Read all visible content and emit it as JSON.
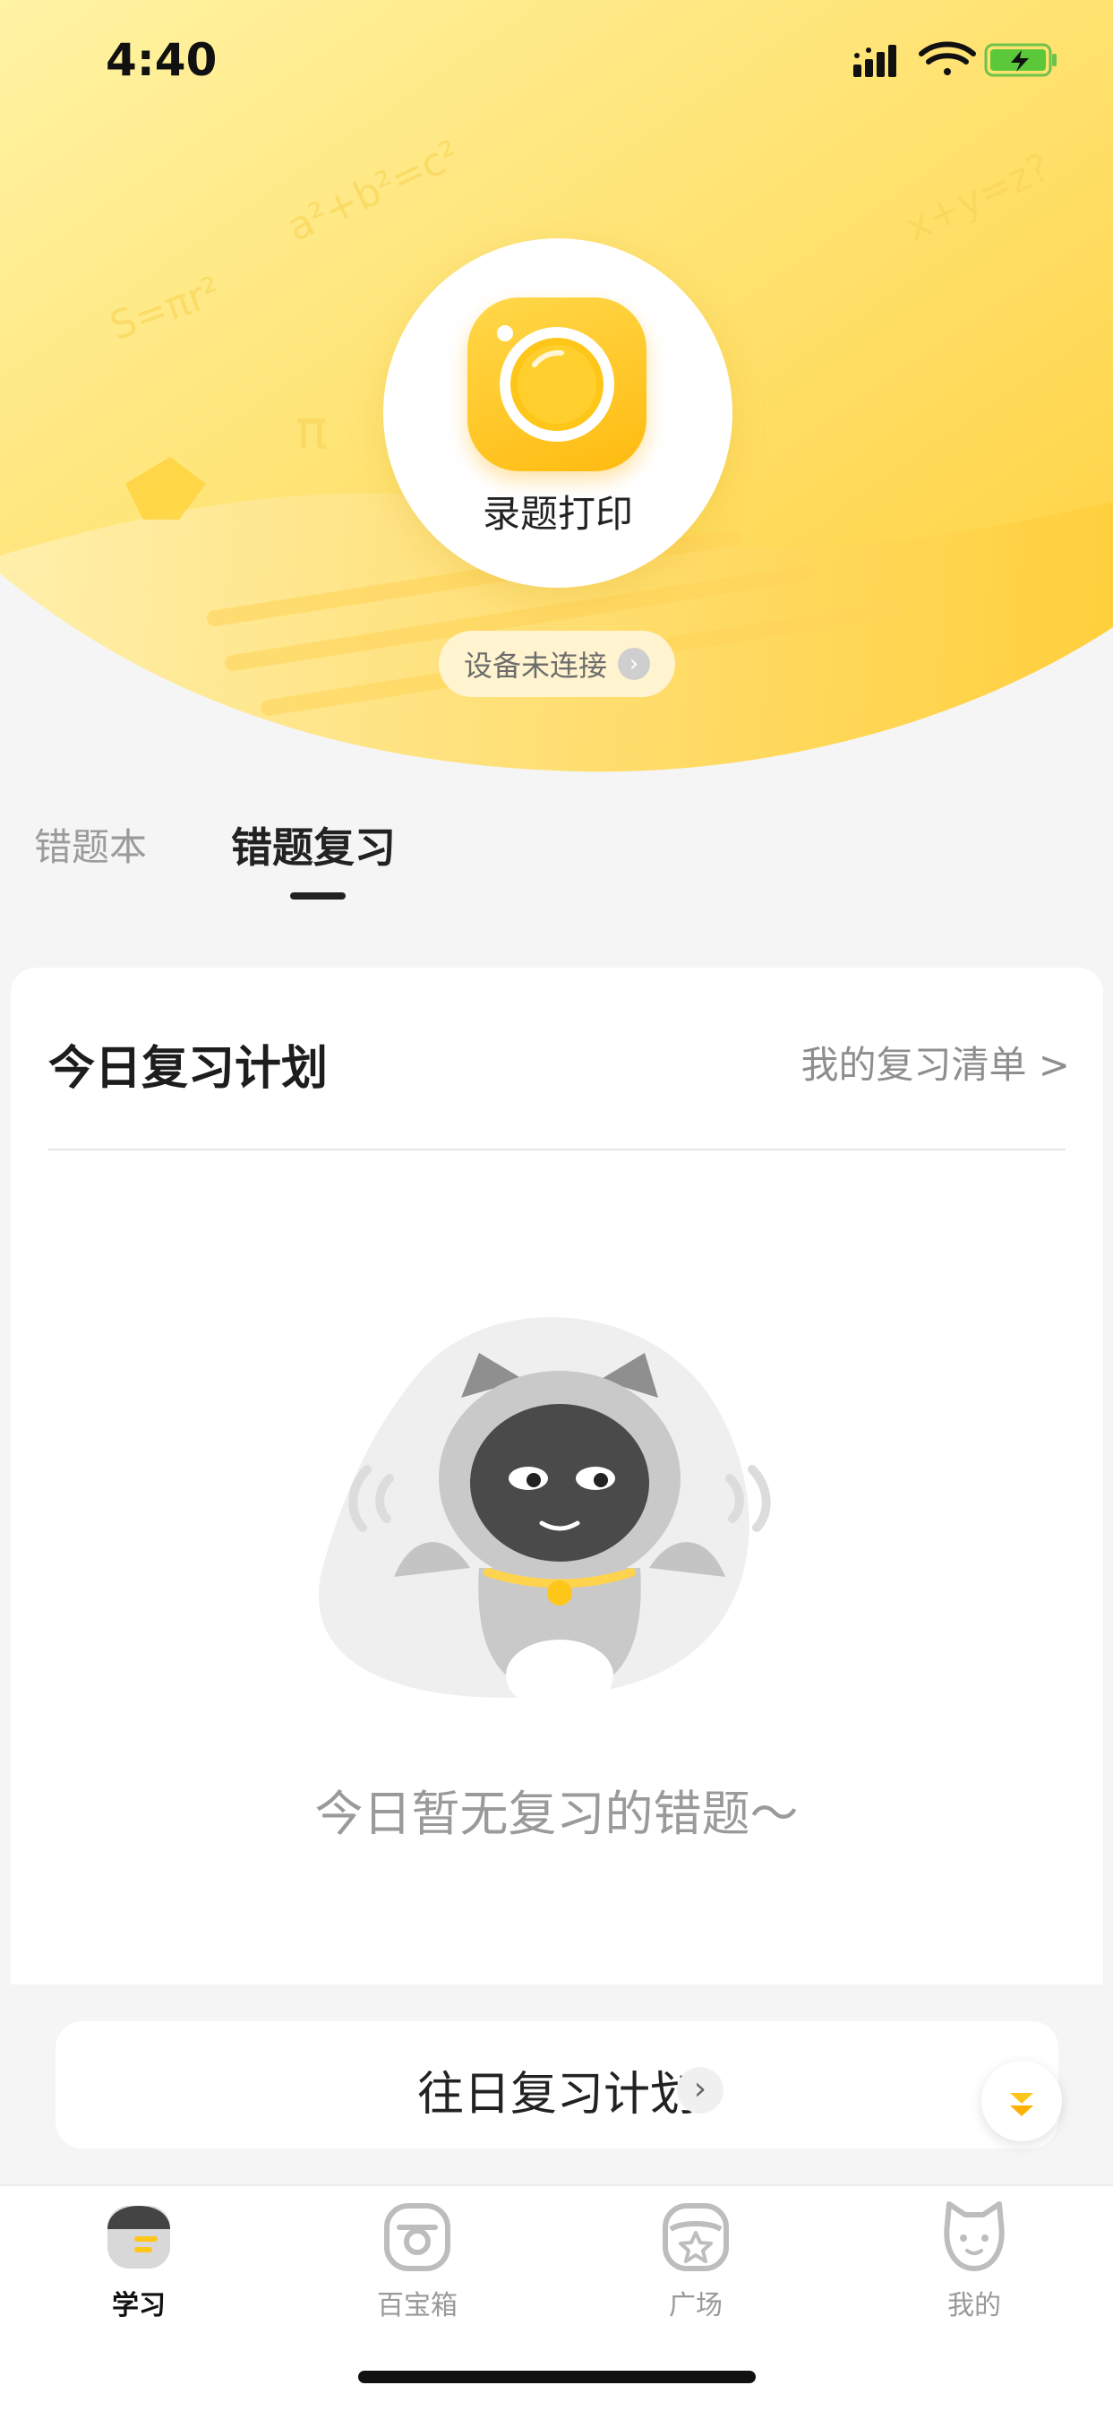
{
  "status_bar": {
    "time": "4:40"
  },
  "hero": {
    "action_label": "录题打印",
    "device_status": "设备未连接"
  },
  "tabs": [
    {
      "label": "错题本",
      "active": false
    },
    {
      "label": "错题复习",
      "active": true
    }
  ],
  "review_card": {
    "title": "今日复习计划",
    "link_label": "我的复习清单 >",
    "empty_message": "今日暂无复习的错题～"
  },
  "past_plan": {
    "label": "往日复习计划"
  },
  "bottom_nav": [
    {
      "label": "学习",
      "icon": "study-icon",
      "active": true
    },
    {
      "label": "百宝箱",
      "icon": "treasure-box-icon",
      "active": false
    },
    {
      "label": "广场",
      "icon": "square-icon",
      "active": false
    },
    {
      "label": "我的",
      "icon": "profile-cat-icon",
      "active": false
    }
  ],
  "colors": {
    "brand_yellow": "#ffc61a",
    "hero_light": "#fff1a6",
    "text_primary": "#222222",
    "text_secondary": "#9a9a9a"
  }
}
